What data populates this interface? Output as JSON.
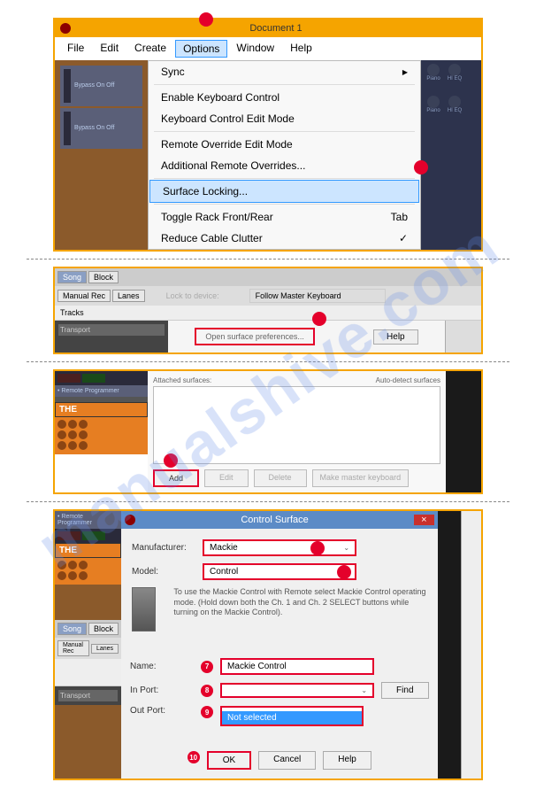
{
  "watermark": "manualshive.com",
  "panel1": {
    "doc_title": "Document 1",
    "menu": {
      "file": "File",
      "edit": "Edit",
      "create": "Create",
      "options": "Options",
      "window": "Window",
      "help": "Help"
    },
    "dropdown": {
      "sync": "Sync",
      "enable_kb": "Enable Keyboard Control",
      "kb_edit": "Keyboard Control Edit Mode",
      "remote_override": "Remote Override Edit Mode",
      "add_remote": "Additional Remote Overrides...",
      "surface_locking": "Surface Locking...",
      "toggle_rack": "Toggle Rack Front/Rear",
      "toggle_rack_key": "Tab",
      "reduce": "Reduce Cable Clutter"
    },
    "rack_label": "Bypass\nOn\nOff",
    "knobs": [
      "Piano",
      "HI EQ"
    ]
  },
  "panel2": {
    "tabs": {
      "song": "Song",
      "block": "Block"
    },
    "row2": {
      "manual": "Manual Rec",
      "lanes": "Lanes"
    },
    "lock_label": "Lock to device:",
    "follow_master": "Follow Master Keyboard",
    "tracks": "Tracks",
    "link": "Open surface preferences...",
    "help": "Help",
    "transport": "Transport"
  },
  "panel3": {
    "attached": "Attached surfaces:",
    "auto": "Auto-detect surfaces",
    "btns": {
      "add": "Add",
      "edit": "Edit",
      "delete": "Delete",
      "master": "Make master keyboard"
    },
    "the": "THE",
    "remote_prog": "• Remote Programmer"
  },
  "panel4": {
    "title": "Control Surface",
    "manufacturer_label": "Manufacturer:",
    "manufacturer": "Mackie",
    "model_label": "Model:",
    "model": "Control",
    "info": "To use the Mackie Control with Remote select Mackie Control operating mode. (Hold down both the Ch. 1 and Ch. 2 SELECT buttons while turning on the Mackie Control).",
    "name_label": "Name:",
    "name_value": "Mackie Control",
    "in_port_label": "In Port:",
    "in_port_value": "",
    "find": "Find",
    "out_port_label": "Out Port:",
    "out_options": [
      "",
      "Not selected"
    ],
    "footer": {
      "ok": "OK",
      "cancel": "Cancel",
      "help": "Help"
    },
    "nums": {
      "n7": "7",
      "n8": "8",
      "n9": "9",
      "n10": "10"
    },
    "remote_prog": "• Remote Programmer",
    "the": "THE",
    "tabs": {
      "song": "Song",
      "block": "Block"
    },
    "row2": {
      "manual": "Manual Rec",
      "lanes": "Lanes"
    },
    "transport": "Transport"
  }
}
